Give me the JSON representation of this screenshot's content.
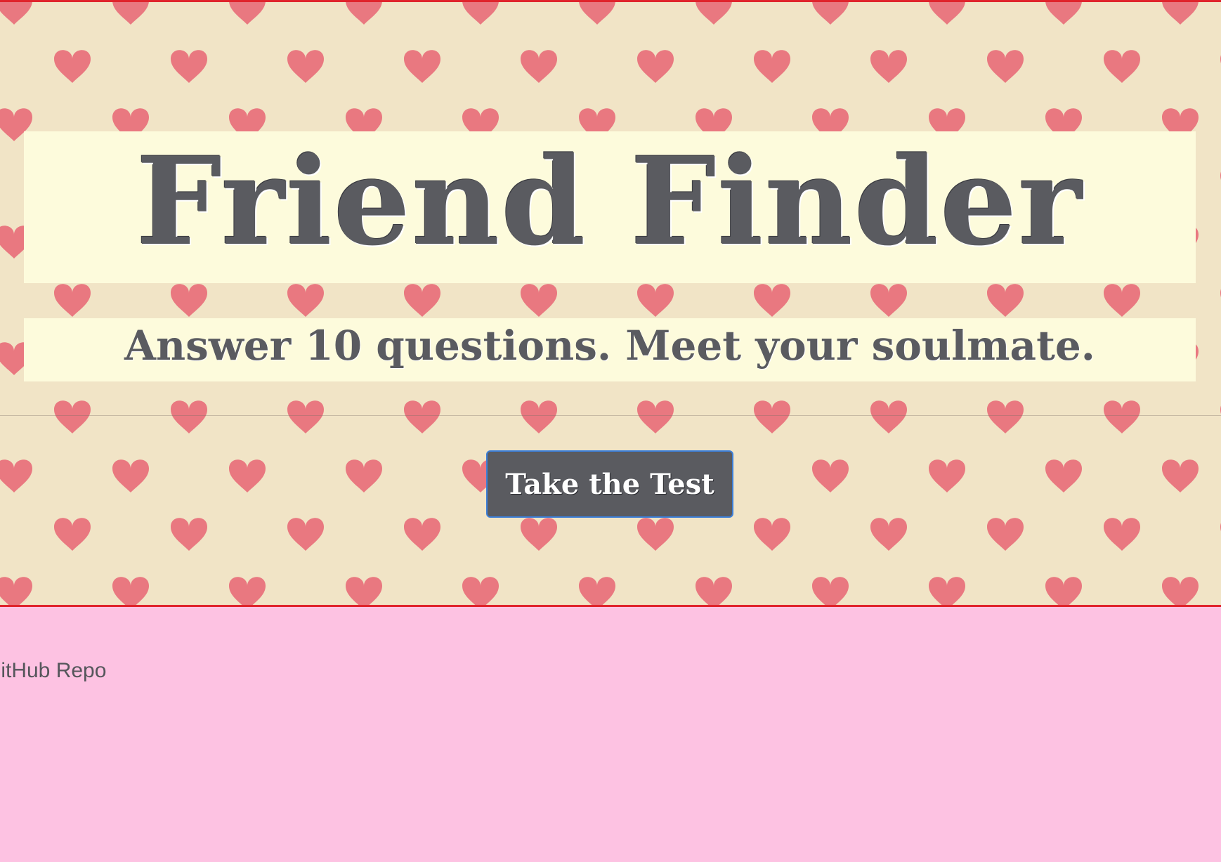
{
  "hero": {
    "title": "Friend Finder",
    "subtitle": "Answer 10 questions. Meet your soulmate.",
    "cta_label": "Take the Test"
  },
  "footer": {
    "repo_link": "GitHub Repo"
  },
  "colors": {
    "accent_border": "#e0242c",
    "page_background": "#fdc2e2",
    "hero_background": "#f1e4c6",
    "heart": "#e86b78",
    "text_dark": "#5a5b60",
    "title_panel": "#fdfbdc",
    "button_focus": "#3d7fd8"
  },
  "icons": {
    "pattern": "heart-icon"
  }
}
